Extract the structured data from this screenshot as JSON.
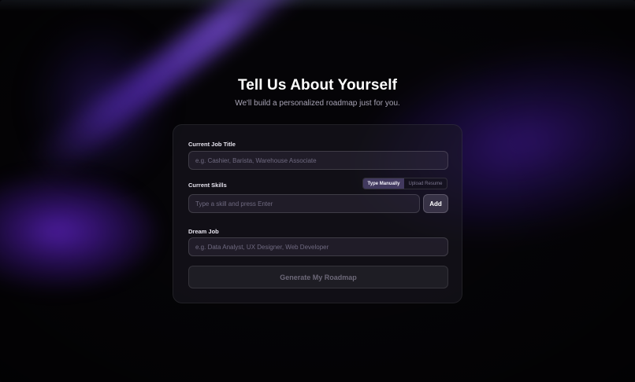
{
  "header": {
    "title": "Tell Us About Yourself",
    "subtitle": "We'll build a personalized roadmap just for you."
  },
  "form": {
    "job_title": {
      "label": "Current Job Title",
      "value": "",
      "placeholder": "e.g. Cashier, Barista, Warehouse Associate"
    },
    "skills": {
      "label": "Current Skills",
      "mode_options": [
        "Type Manually",
        "Upload Resume"
      ],
      "selected_mode": "Type Manually",
      "value": "",
      "placeholder": "Type a skill and press Enter",
      "add_label": "Add"
    },
    "dream_job": {
      "label": "Dream Job",
      "value": "",
      "placeholder": "e.g. Data Analyst, UX Designer, Web Developer"
    },
    "submit_label": "Generate My Roadmap",
    "submit_enabled": false
  },
  "colors": {
    "background": "#050407",
    "accent_glow": "#6e28e6",
    "text_primary": "#ffffff",
    "text_muted": "#a7a3b4"
  }
}
